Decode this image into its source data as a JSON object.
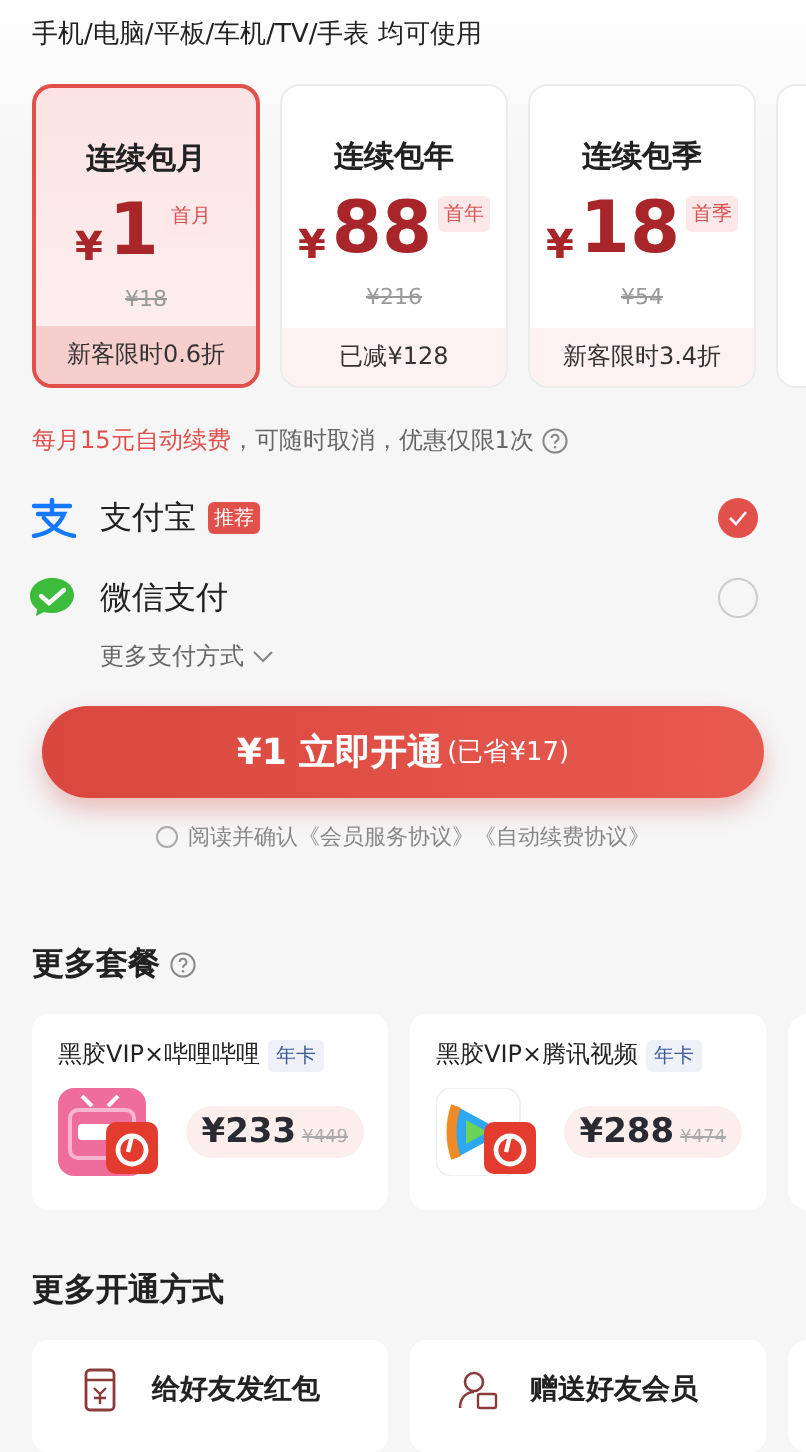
{
  "header": {
    "text": "手机/电脑/平板/车机/TV/手表 均可使用"
  },
  "plans": [
    {
      "name": "连续包月",
      "currency": "¥",
      "price": "1",
      "tag": "首月",
      "original": "¥18",
      "note": "新客限时0.6折",
      "selected": true
    },
    {
      "name": "连续包年",
      "currency": "¥",
      "price": "88",
      "tag": "首年",
      "original": "¥216",
      "note": "已减¥128",
      "selected": false
    },
    {
      "name": "连续包季",
      "currency": "¥",
      "price": "18",
      "tag": "首季",
      "original": "¥54",
      "note": "新客限时3.4折",
      "selected": false
    }
  ],
  "renewal_notice": {
    "highlight": "每月15元自动续费",
    "rest": "，可随时取消，优惠仅限1次"
  },
  "payment_methods": [
    {
      "kind": "alipay",
      "name": "支付宝",
      "badge": "推荐",
      "selected": true
    },
    {
      "kind": "wechat",
      "name": "微信支付",
      "selected": false
    }
  ],
  "more_payment": "更多支付方式",
  "pay_button": {
    "main": "¥1 立即开通",
    "saved": "(已省¥17)"
  },
  "agreement": {
    "checked": false,
    "prefix": "阅读并确认",
    "links": [
      "《会员服务协议》",
      "《自动续费协议》"
    ]
  },
  "bundles_section": {
    "title": "更多套餐",
    "items": [
      {
        "kind": "bilibili",
        "title": "黑胶VIP×哔哩哔哩",
        "tag": "年卡",
        "price": "¥233",
        "original": "¥449"
      },
      {
        "kind": "tencent",
        "title": "黑胶VIP×腾讯视频",
        "tag": "年卡",
        "price": "¥288",
        "original": "¥474"
      }
    ]
  },
  "methods_section": {
    "title": "更多开通方式",
    "items": [
      {
        "kind": "red-packet",
        "label": "给好友发红包"
      },
      {
        "kind": "gift",
        "label": "赠送好友会员"
      }
    ]
  }
}
